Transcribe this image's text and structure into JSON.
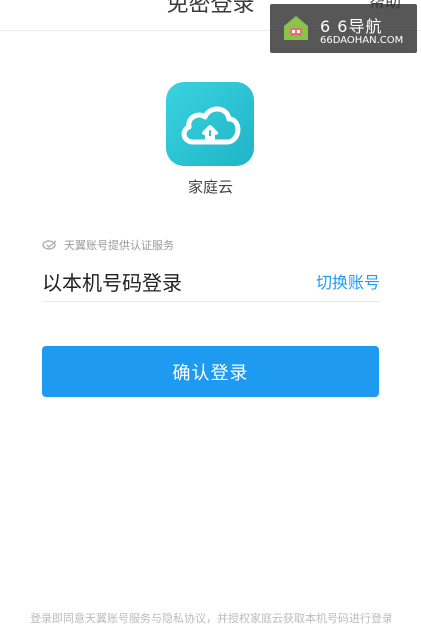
{
  "header": {
    "title": "免密登录",
    "help": "帮助"
  },
  "watermark": {
    "title": "6 6导航",
    "subtitle": "66DAOHAN.COM"
  },
  "app": {
    "name": "家庭云",
    "icon": "cloud-home-icon"
  },
  "provider": {
    "text": "天翼账号提供认证服务",
    "icon": "tianyi-logo-icon"
  },
  "login": {
    "method_label": "以本机号码登录",
    "switch_label": "切换账号"
  },
  "confirm_button": {
    "label": "确认登录"
  },
  "footer": {
    "text": "登录即同意天翼账号服务与隐私协议，并授权家庭云获取本机号码进行登录"
  },
  "colors": {
    "accent": "#1e9af0",
    "icon_bg": "#2cc6d6"
  }
}
